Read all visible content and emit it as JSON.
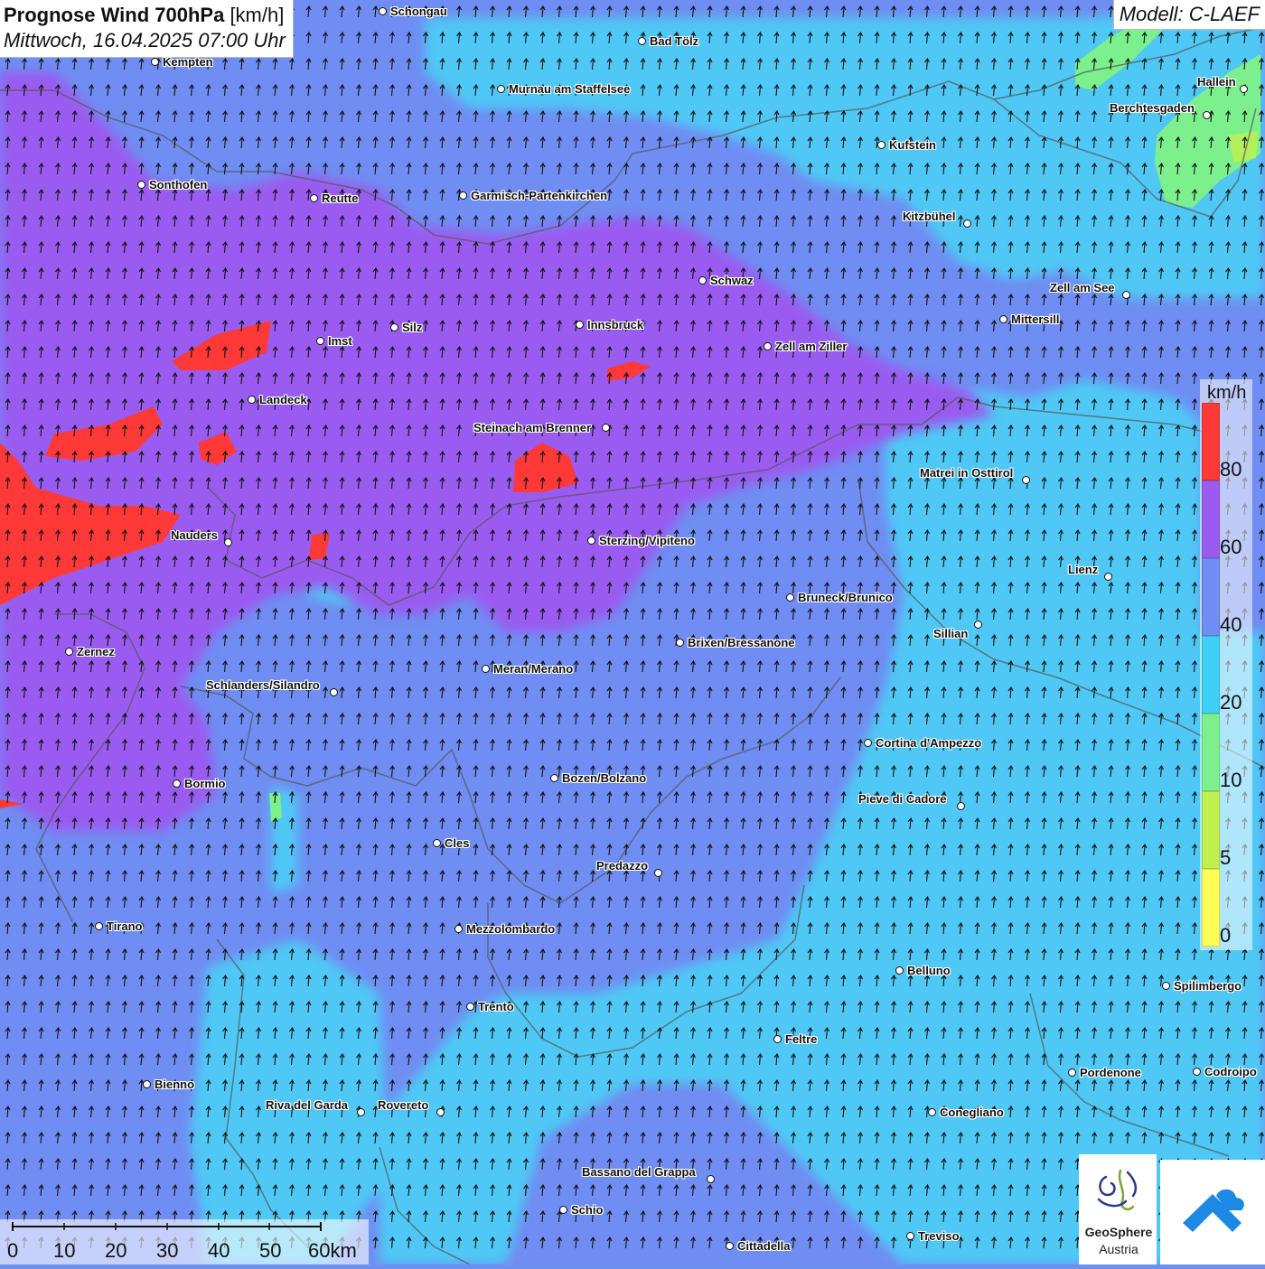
{
  "header": {
    "title_bold": "Prognose Wind 700hPa",
    "title_unit": "[km/h]",
    "datetime": "Mittwoch, 16.04.2025 07:00 Uhr",
    "model": "Modell: C-LAEF"
  },
  "legend": {
    "unit": "km/h",
    "labels": [
      "80",
      "60",
      "40",
      "20",
      "10",
      "5",
      "0"
    ],
    "colors": [
      "#ff3838",
      "#9a5cf0",
      "#6f8df2",
      "#3fd0f7",
      "#7cf08c",
      "#c0f050",
      "#ffff55"
    ]
  },
  "scale_bar": {
    "labels": [
      "0",
      "10",
      "20",
      "30",
      "40",
      "50",
      "60km"
    ]
  },
  "logos": {
    "geosphere_line1": "GeoSphere",
    "geosphere_line2": "Austria"
  },
  "icons": {
    "wind_arrow": "wind-direction-arrow-icon",
    "city": "city-marker-icon"
  },
  "cities": [
    {
      "name": "Schongau"
    },
    {
      "name": "Bad Tölz"
    },
    {
      "name": "Kempten"
    },
    {
      "name": "Murnau am Staffelsee"
    },
    {
      "name": "Hallein"
    },
    {
      "name": "Berchtesgaden"
    },
    {
      "name": "Kufstein"
    },
    {
      "name": "Sonthofen"
    },
    {
      "name": "Reutte"
    },
    {
      "name": "Garmisch-Partenkirchen"
    },
    {
      "name": "Kitzbühel"
    },
    {
      "name": "Schwaz"
    },
    {
      "name": "Zell am See"
    },
    {
      "name": "Mittersill"
    },
    {
      "name": "Imst"
    },
    {
      "name": "Silz"
    },
    {
      "name": "Innsbruck"
    },
    {
      "name": "Zell am Ziller"
    },
    {
      "name": "Landeck"
    },
    {
      "name": "Steinach am Brenner"
    },
    {
      "name": "Matrei in Osttirol"
    },
    {
      "name": "Nauders"
    },
    {
      "name": "Sterzing/Vipiteno"
    },
    {
      "name": "Lienz"
    },
    {
      "name": "Bruneck/Brunico"
    },
    {
      "name": "Sillian"
    },
    {
      "name": "Zernez"
    },
    {
      "name": "Brixen/Bressanone"
    },
    {
      "name": "Meran/Merano"
    },
    {
      "name": "Schlanders/Silandro"
    },
    {
      "name": "Cortina d'Ampezzo"
    },
    {
      "name": "Bozen/Bolzano"
    },
    {
      "name": "Bormio"
    },
    {
      "name": "Pieve di Cadore"
    },
    {
      "name": "Cles"
    },
    {
      "name": "Predazzo"
    },
    {
      "name": "Tirano"
    },
    {
      "name": "Mezzolombardo"
    },
    {
      "name": "Belluno"
    },
    {
      "name": "Spilimbergo"
    },
    {
      "name": "Trento"
    },
    {
      "name": "Feltre"
    },
    {
      "name": "Pordenone"
    },
    {
      "name": "Codroipo"
    },
    {
      "name": "Bienno"
    },
    {
      "name": "Riva del Garda"
    },
    {
      "name": "Rovereto"
    },
    {
      "name": "Conegliano"
    },
    {
      "name": "Bassano del Grappa"
    },
    {
      "name": "Schio"
    },
    {
      "name": "Treviso"
    },
    {
      "name": "Cittadella"
    }
  ]
}
